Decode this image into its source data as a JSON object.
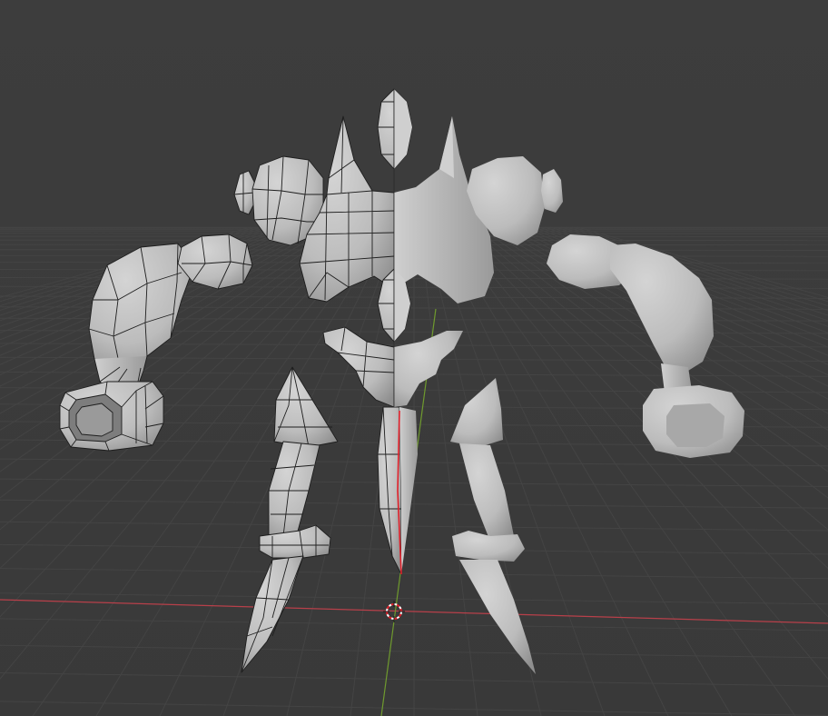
{
  "viewport": {
    "background_color": "#3b3b3b",
    "grid_color": "#444444",
    "x_axis_color": "#b8404a",
    "y_axis_color": "#6f9a2e",
    "bone_color": "#e0202a",
    "mesh_color": "#bdbdbd",
    "wire_color": "#1e1e1e",
    "cursor_icon": "3d-cursor-icon"
  }
}
